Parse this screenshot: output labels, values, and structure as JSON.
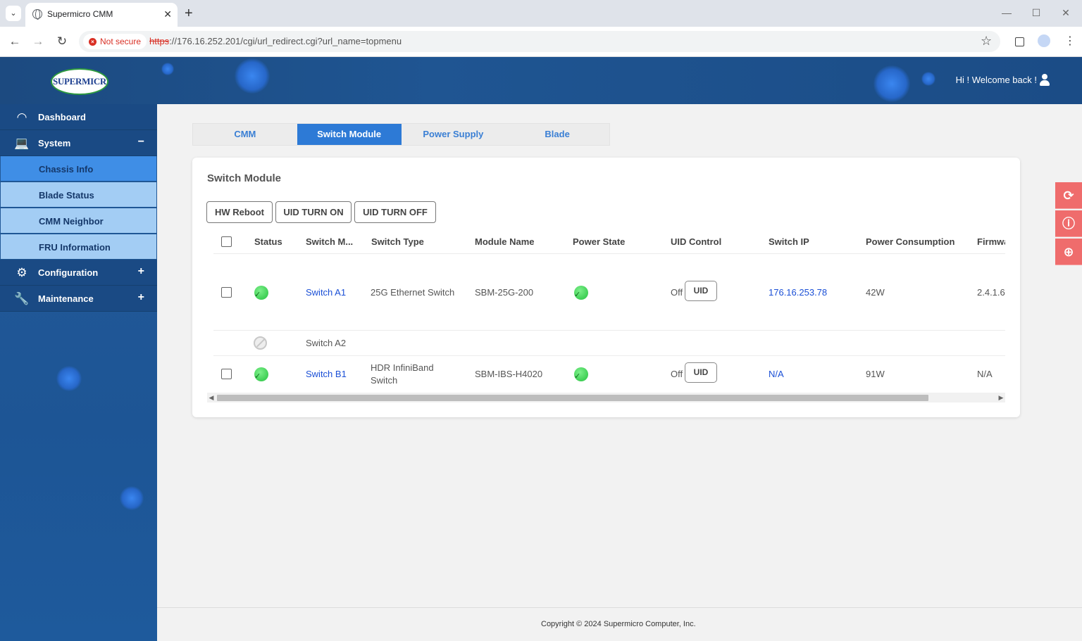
{
  "browser": {
    "tab_title": "Supermicro CMM",
    "security_label": "Not secure",
    "url_scheme": "https",
    "url_rest": "://176.16.252.201/cgi/url_redirect.cgi?url_name=topmenu"
  },
  "header": {
    "logo_text": "SUPERMICR",
    "welcome": "Hi ! Welcome back !"
  },
  "sidebar": {
    "items": [
      {
        "label": "Dashboard",
        "icon": "dashboard-gauge-icon"
      },
      {
        "label": "System",
        "icon": "laptop-icon",
        "toggle": "−"
      },
      {
        "label": "Configuration",
        "icon": "gear-icon",
        "toggle": "+"
      },
      {
        "label": "Maintenance",
        "icon": "wrench-icon",
        "toggle": "+"
      }
    ],
    "system_sub": [
      {
        "label": "Chassis Info"
      },
      {
        "label": "Blade Status"
      },
      {
        "label": "CMM Neighbor"
      },
      {
        "label": "FRU Information"
      }
    ]
  },
  "main_tabs": [
    "CMM",
    "Switch Module",
    "Power Supply",
    "Blade"
  ],
  "panel": {
    "title": "Switch Module",
    "actions": [
      "HW Reboot",
      "UID TURN ON",
      "UID TURN OFF"
    ]
  },
  "table": {
    "columns": [
      "Status",
      "Switch M...",
      "Switch Type",
      "Module Name",
      "Power State",
      "UID Control",
      "Switch IP",
      "Power Consumption",
      "Firmwa"
    ],
    "rows": [
      {
        "status": "ok",
        "name": "Switch A1",
        "type": "25G Ethernet Switch",
        "module": "SBM-25G-200",
        "power": "ok",
        "uid_state": "Off",
        "uid_btn": "UID",
        "ip": "176.16.253.78",
        "consumption": "42W",
        "firmware": "2.4.1.6"
      },
      {
        "status": "na",
        "name": "Switch A2"
      },
      {
        "status": "ok",
        "name": "Switch B1",
        "type_line1": "HDR InfiniBand",
        "type_line2": "Switch",
        "module": "SBM-IBS-H4020",
        "power": "ok",
        "uid_state": "Off",
        "uid_btn": "UID",
        "ip": "N/A",
        "consumption": "91W",
        "firmware": "N/A"
      }
    ]
  },
  "footer": {
    "copyright": "Copyright © 2024 Supermicro Computer, Inc."
  },
  "colors": {
    "header_blue": "#1f5592",
    "active_tab": "#2d7ad6",
    "status_green": "#3fcf55",
    "link_blue": "#1a4fd6",
    "float_red": "#ef6c6c"
  }
}
